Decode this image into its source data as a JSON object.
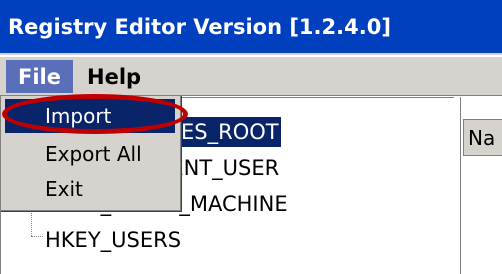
{
  "window": {
    "title": "Registry Editor Version [1.2.4.0]"
  },
  "menubar": {
    "file_label": "File",
    "help_label": "Help"
  },
  "file_menu": {
    "items": [
      {
        "label": "Import"
      },
      {
        "label": "Export All"
      },
      {
        "label": "Exit"
      }
    ]
  },
  "tree": {
    "nodes": [
      {
        "label": "HKEY_CLASSES_ROOT"
      },
      {
        "label": "HKEY_CURRENT_USER"
      },
      {
        "label": "HKEY_LOCAL_MACHINE"
      },
      {
        "label": "HKEY_USERS"
      }
    ]
  },
  "list_view": {
    "name_column": "Na"
  },
  "colors": {
    "titlebar": "#003fbe",
    "selection": "#0a246a",
    "annotation": "#c00000"
  }
}
